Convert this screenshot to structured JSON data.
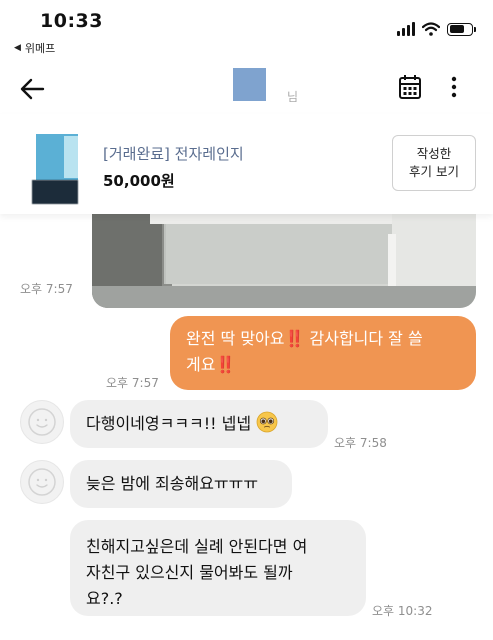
{
  "status": {
    "time": "10:33",
    "back_app": "위메프"
  },
  "header": {
    "name_suffix": "님"
  },
  "product": {
    "title": "[거래완료] 전자레인지",
    "price": "50,000원",
    "review_button": [
      "작성한",
      "후기 보기"
    ]
  },
  "messages": [
    {
      "time": "오후 7:57"
    },
    {
      "text_lines": [
        "완전 딱 맞아요‼️ 감사합니다 잘 쓸",
        "게요‼️"
      ],
      "time": "오후 7:57"
    },
    {
      "text": "다행이네영ㅋㅋㅋ!! 넵넵",
      "time": "오후 7:58"
    },
    {
      "text": "늦은 밤에 죄송해요ㅠㅠㅠ"
    },
    {
      "text_lines": [
        "친해지고싶은데 실례 안된다면 여",
        "자친구 있으신지 물어봐도 될까",
        "요?.?"
      ],
      "time": "오후 10:32"
    }
  ],
  "colors": {
    "outgoing_bubble": "#f09552",
    "incoming_bubble": "#efefef",
    "product_title": "#5a6d8f"
  },
  "icons": [
    "back-arrow-icon",
    "calendar-icon",
    "more-vertical-icon",
    "signal-icon",
    "wifi-icon",
    "battery-icon",
    "pleading-face-emoji",
    "profile-placeholder-icon"
  ]
}
